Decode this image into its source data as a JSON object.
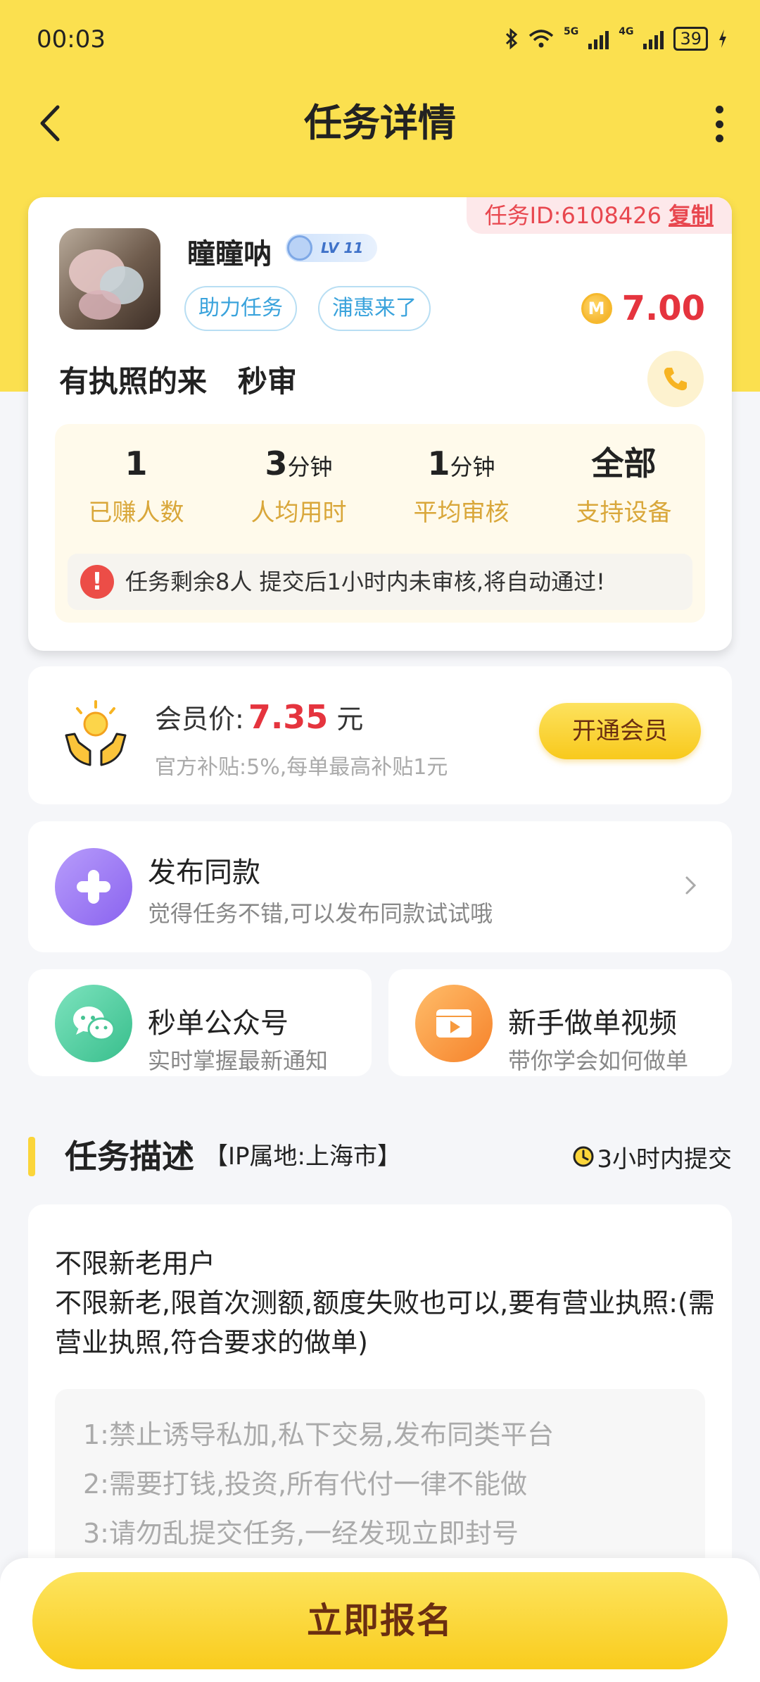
{
  "status_bar": {
    "time": "00:03",
    "net1": "5G",
    "net2": "4G",
    "battery": "39"
  },
  "header": {
    "title": "任务详情"
  },
  "task": {
    "id_label": "任务ID:6108426",
    "copy_label": "复制",
    "user_name": "瞳瞳呐",
    "level": "LV 11",
    "tags": [
      "助力任务",
      "浦惠来了"
    ],
    "coin_symbol": "M",
    "reward": "7.00",
    "name": "有执照的来   秒审",
    "stats": [
      {
        "value": "1",
        "unit": "",
        "label": "已赚人数"
      },
      {
        "value": "3",
        "unit": "分钟",
        "label": "人均用时"
      },
      {
        "value": "1",
        "unit": "分钟",
        "label": "平均审核"
      },
      {
        "value": "全部",
        "unit": "",
        "label": "支持设备"
      }
    ],
    "notice": "任务剩余8人  提交后1小时内未审核,将自动通过!"
  },
  "vip": {
    "label": "会员价:",
    "price": "7.35",
    "unit": "元",
    "subsidy": "官方补贴:5%,每单最高补贴1元",
    "button": "开通会员"
  },
  "publish": {
    "title": "发布同款",
    "subtitle": "觉得任务不错,可以发布同款试试哦"
  },
  "cards": [
    {
      "title": "秒单公众号",
      "subtitle": "实时掌握最新通知"
    },
    {
      "title": "新手做单视频",
      "subtitle": "带你学会如何做单"
    }
  ],
  "description": {
    "heading": "任务描述",
    "ip": "【IP属地:上海市】",
    "deadline": "3小时内提交",
    "text": "不限新老用户\n不限新老,限首次测额,额度失败也可以,要有营业执照:(需营业执照,符合要求的做单)",
    "rules": [
      "1:禁止诱导私加,私下交易,发布同类平台",
      "2:需要打钱,投资,所有代付一律不能做",
      "3:请勿乱提交任务,一经发现立即封号"
    ]
  },
  "bottom_button": "立即报名",
  "colors": {
    "header_bg": "#fbe04f",
    "accent_red": "#e5343e",
    "button_yellow": "#f9cc1d"
  }
}
